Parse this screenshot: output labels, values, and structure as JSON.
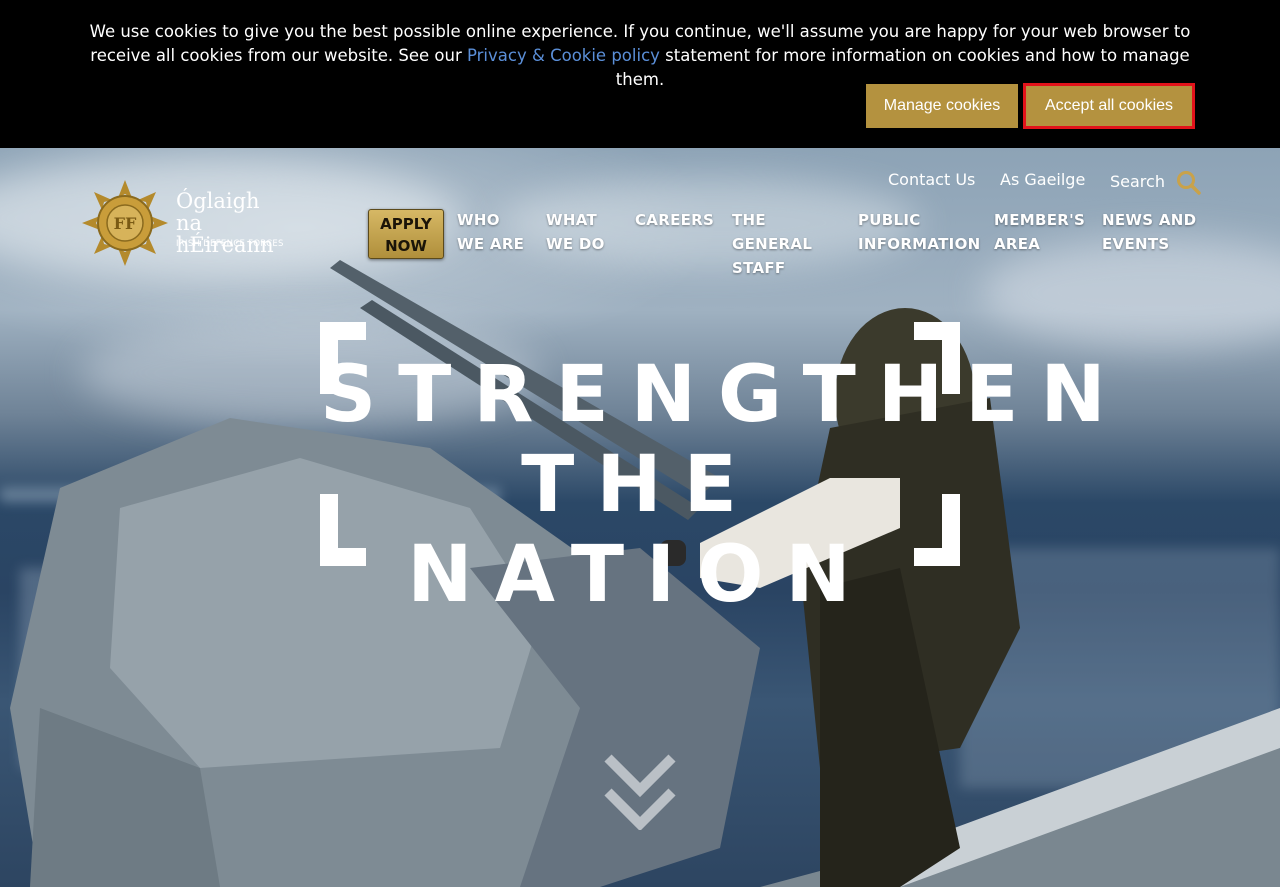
{
  "cookie_banner": {
    "text_before": "We use cookies to give you the best possible online experience. If you continue, we'll assume you are happy for your web browser to receive all cookies from our website. See our ",
    "link_text": "Privacy & Cookie policy",
    "text_after": " statement for more information on cookies and how to manage them.",
    "manage_label": "Manage cookies",
    "accept_label": "Accept all cookies"
  },
  "utility_nav": {
    "contact": "Contact Us",
    "language": "As Gaeilge",
    "search": "Search"
  },
  "logo": {
    "line1": "Óglaigh",
    "line2": "na hÉireann",
    "line3": "IRISH DEFENCE FORCES"
  },
  "apply": {
    "line1": "APPLY",
    "line2": "NOW"
  },
  "nav": [
    {
      "lines": [
        "WHO",
        "WE ARE"
      ]
    },
    {
      "lines": [
        "WHAT",
        "WE DO"
      ]
    },
    {
      "lines": [
        "CAREERS"
      ]
    },
    {
      "lines": [
        "THE",
        "GENERAL",
        "STAFF"
      ]
    },
    {
      "lines": [
        "PUBLIC",
        "INFORMATION"
      ]
    },
    {
      "lines": [
        "MEMBER'S",
        "AREA"
      ]
    },
    {
      "lines": [
        "NEWS AND",
        "EVENTS"
      ]
    }
  ],
  "hero": {
    "headline_line1": "STRENGTHEN",
    "headline_line2": "THE NATION"
  },
  "colors": {
    "gold": "#b4923f",
    "banner_bg": "#000000",
    "link_blue": "#5b8fd8",
    "highlight_red": "#e2131b"
  },
  "icons": {
    "search": "search-icon",
    "scroll": "chevron-double-down-icon",
    "crest": "defence-forces-crest-icon"
  }
}
